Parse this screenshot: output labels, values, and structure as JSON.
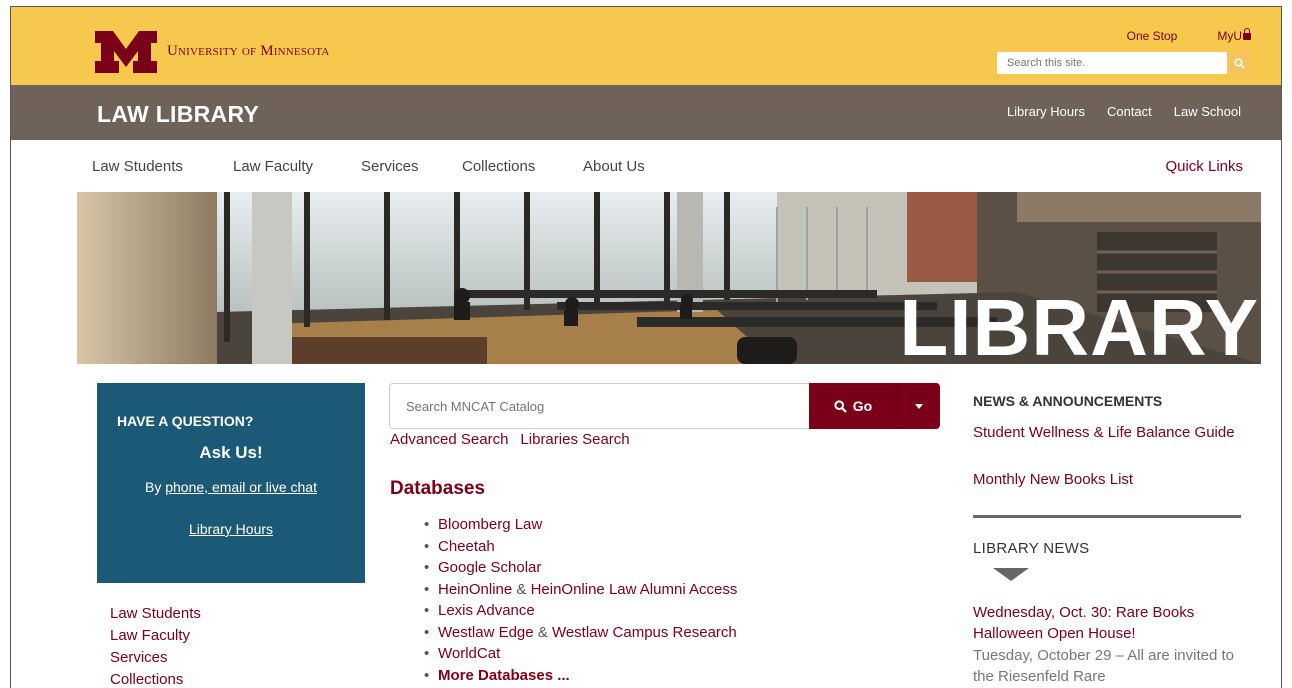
{
  "header": {
    "university": "University of Minnesota",
    "top_links": [
      "One Stop",
      "MyU"
    ],
    "site_search_placeholder": "Search this site."
  },
  "brand": {
    "title": "LAW LIBRARY",
    "links": [
      "Library Hours",
      "Contact",
      "Law School"
    ]
  },
  "nav": {
    "items": [
      "Law Students",
      "Law Faculty",
      "Services",
      "Collections",
      "About Us"
    ],
    "quick_links": "Quick Links"
  },
  "hero": {
    "overlay_text": "LIBRARY"
  },
  "ask_box": {
    "heading": "HAVE A QUESTION?",
    "title": "Ask Us!",
    "by_prefix": "By ",
    "by_link": "phone, email or live chat",
    "hours_link": "Library Hours"
  },
  "left_links": [
    "Law Students",
    "Law Faculty",
    "Services",
    "Collections"
  ],
  "catalog": {
    "placeholder": "Search MNCAT Catalog",
    "go_label": "Go",
    "advanced_search": "Advanced Search",
    "libraries_search": "Libraries Search"
  },
  "databases": {
    "heading": "Databases",
    "items": [
      "Bloomberg Law",
      "Cheetah",
      "Google Scholar",
      {
        "a": "HeinOnline",
        "amp": " & ",
        "b": "HeinOnline Law Alumni Access"
      },
      "Lexis Advance",
      {
        "a": "Westlaw Edge",
        "amp": " & ",
        "b": "Westlaw Campus Research"
      },
      "WorldCat",
      "More Databases ..."
    ]
  },
  "news": {
    "heading": "NEWS & ANNOUNCEMENTS",
    "items": [
      "Student Wellness & Life Balance Guide",
      "Monthly New Books List"
    ]
  },
  "library_news": {
    "heading": "LIBRARY NEWS",
    "event_title": "Wednesday, Oct. 30: Rare Books Halloween Open House!",
    "event_text": "Tuesday, October 29 – All are invited to the Riesenfeld Rare"
  },
  "colors": {
    "gold": "#f6c94e",
    "maroon": "#7a0019",
    "brown": "#6f6259",
    "blue": "#1b5977"
  }
}
